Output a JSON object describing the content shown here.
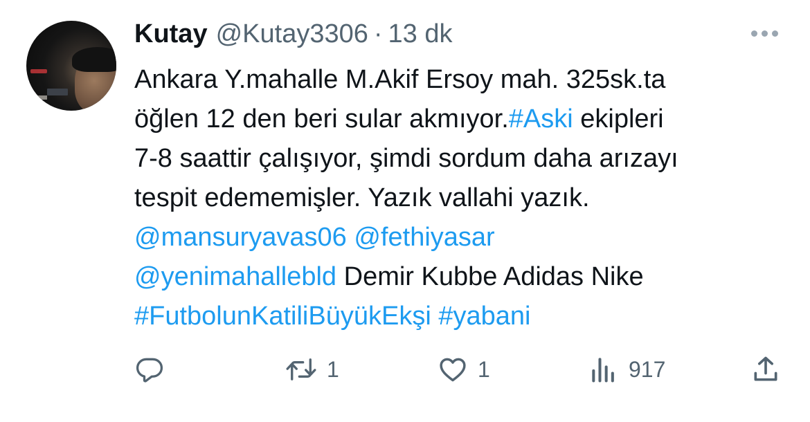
{
  "author": {
    "name": "Kutay",
    "handle": "@Kutay3306",
    "separator": "·",
    "time": "13 dk"
  },
  "tweet": {
    "lines": [
      [
        {
          "text": "Ankara Y.mahalle M.Akif Ersoy mah. 325sk.ta",
          "type": "text"
        }
      ],
      [
        {
          "text": "öğlen 12 den beri sular akmıyor.",
          "type": "text"
        },
        {
          "text": "#Aski",
          "type": "hashtag"
        },
        {
          "text": " ekipleri",
          "type": "text"
        }
      ],
      [
        {
          "text": "7-8 saattir çalışıyor, şimdi sordum daha arızayı",
          "type": "text"
        }
      ],
      [
        {
          "text": "tespit edememişler. Yazık vallahi yazık.",
          "type": "text"
        }
      ],
      [
        {
          "text": "@mansuryavas06",
          "type": "mention"
        },
        {
          "text": " ",
          "type": "text"
        },
        {
          "text": "@fethiyasar",
          "type": "mention"
        }
      ],
      [
        {
          "text": "@yenimahallebld",
          "type": "mention"
        },
        {
          "text": " Demir Kubbe Adidas Nike",
          "type": "text"
        }
      ],
      [
        {
          "text": "#FutbolunKatiliBüyükEkşi",
          "type": "hashtag"
        },
        {
          "text": " ",
          "type": "text"
        },
        {
          "text": "#yabani",
          "type": "hashtag"
        }
      ]
    ]
  },
  "metrics": {
    "replies": "",
    "retweets": "1",
    "likes": "1",
    "views": "917"
  },
  "colors": {
    "link": "#1d9bf0",
    "text": "#0f1419",
    "muted": "#536471"
  },
  "icons": {
    "more": "more-dots-icon",
    "reply": "reply-icon",
    "retweet": "retweet-icon",
    "like": "heart-icon",
    "views": "views-bar-chart-icon",
    "share": "share-icon"
  }
}
